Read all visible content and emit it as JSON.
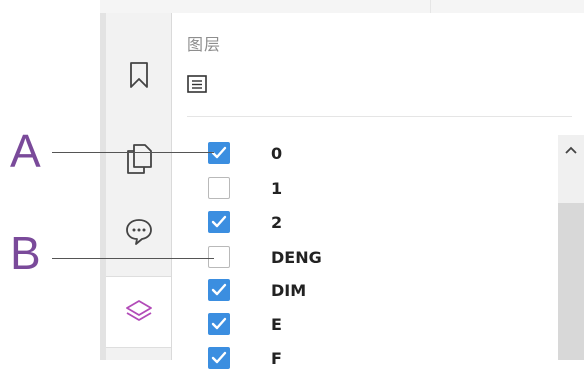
{
  "panel": {
    "title": "图层",
    "tool_icon": "list-icon"
  },
  "sidebar": {
    "items": [
      {
        "icon": "bookmark-icon"
      },
      {
        "icon": "pages-icon"
      },
      {
        "icon": "comment-icon"
      },
      {
        "icon": "layers-icon",
        "active": true
      }
    ]
  },
  "layers": [
    {
      "name": "0",
      "checked": true
    },
    {
      "name": "1",
      "checked": false
    },
    {
      "name": "2",
      "checked": true
    },
    {
      "name": "DENG",
      "checked": false
    },
    {
      "name": "DIM",
      "checked": true
    },
    {
      "name": "E",
      "checked": true
    },
    {
      "name": "F",
      "checked": true
    }
  ],
  "callouts": [
    {
      "label": "A"
    },
    {
      "label": "B"
    }
  ],
  "colors": {
    "checkbox": "#3b8ee0",
    "layers_icon": "#b24bb8",
    "callout": "#7a4a9a"
  }
}
